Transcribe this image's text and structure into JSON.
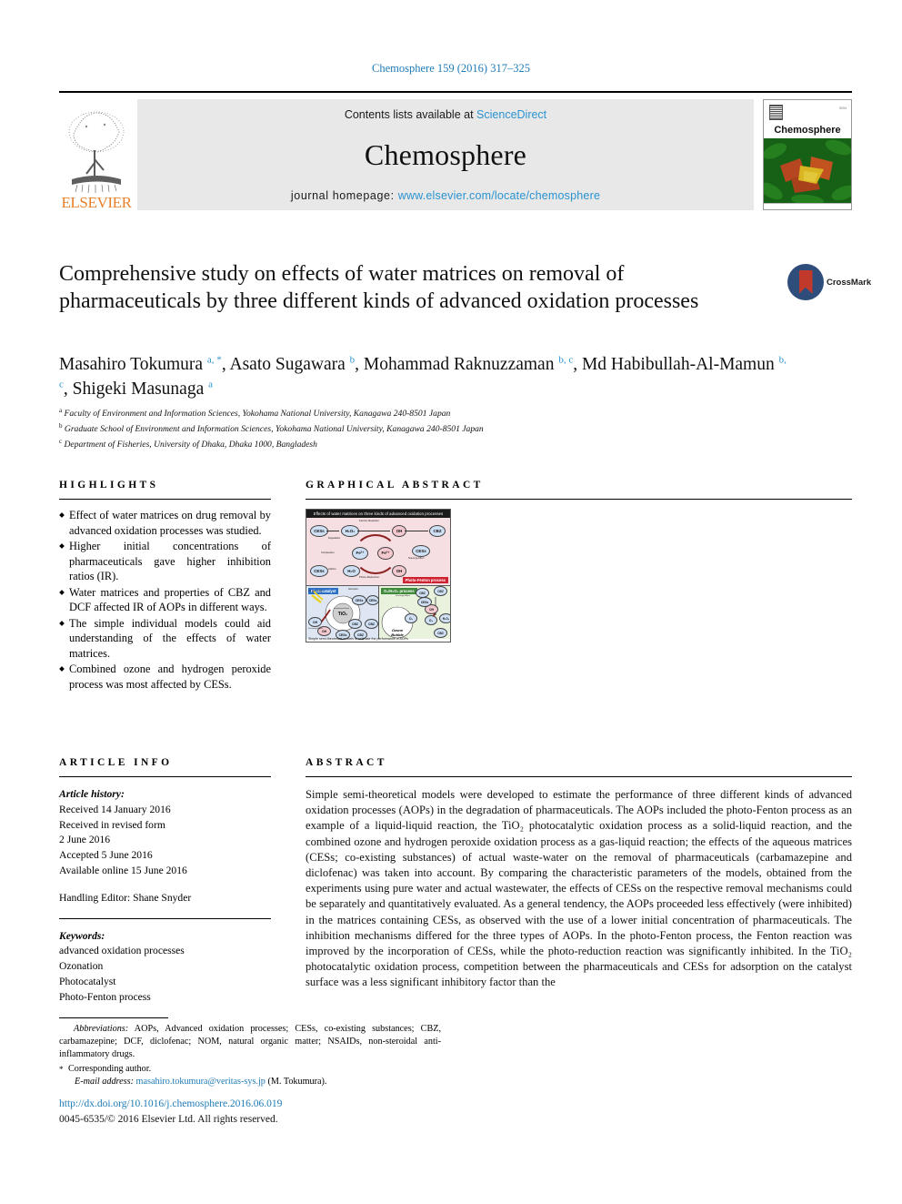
{
  "running_head": "Chemosphere 159 (2016) 317–325",
  "masthead": {
    "contents_prefix": "Contents lists available at",
    "contents_link": "ScienceDirect",
    "journal_name": "Chemosphere",
    "homepage_prefix": "journal homepage:",
    "homepage_url": "www.elsevier.com/locate/chemosphere",
    "publisher_logo_text": "ELSEVIER",
    "cover_title": "Chemosphere",
    "link_color": "#2a93d0",
    "elsevier_orange": "#e8802a"
  },
  "title": "Comprehensive study on effects of water matrices on removal of pharmaceuticals by three different kinds of advanced oxidation processes",
  "crossmark": {
    "label": "CrossMark"
  },
  "authors": [
    {
      "name": "Masahiro Tokumura",
      "marks": "a, *",
      "sep": ", "
    },
    {
      "name": "Asato Sugawara",
      "marks": "b",
      "sep": ", "
    },
    {
      "name": "Mohammad Raknuzzaman",
      "marks": "b, c",
      "sep": ", "
    },
    {
      "name": "Md Habibullah-Al-Mamun",
      "marks": "b, c",
      "sep": ", "
    },
    {
      "name": "Shigeki Masunaga",
      "marks": "a",
      "sep": ""
    }
  ],
  "affiliations": [
    {
      "mark": "a",
      "text": "Faculty of Environment and Information Sciences, Yokohama National University, Kanagawa 240-8501 Japan"
    },
    {
      "mark": "b",
      "text": "Graduate School of Environment and Information Sciences, Yokohama National University, Kanagawa 240-8501 Japan"
    },
    {
      "mark": "c",
      "text": "Department of Fisheries, University of Dhaka, Dhaka 1000, Bangladesh"
    }
  ],
  "sections": {
    "highlights_heading": "HIGHLIGHTS",
    "graphical_abstract_heading": "GRAPHICAL ABSTRACT",
    "article_info_heading": "ARTICLE INFO",
    "abstract_heading": "ABSTRACT"
  },
  "highlights": [
    "Effect of water matrices on drug removal by advanced oxidation processes was studied.",
    "Higher initial concentrations of pharmaceuticals gave higher inhibition ratios (IR).",
    "Water matrices and properties of CBZ and DCF affected IR of AOPs in different ways.",
    "The simple individual models could aid understanding of the effects of water matrices.",
    "Combined ozone and hydrogen peroxide process was most affected by CESs."
  ],
  "graphical_abstract": {
    "banner": "Effects of water matrices on three kinds of advanced oxidation processes",
    "caption": "Simple semi-theoretical models to estimate the performance of AOPs",
    "panels": {
      "photo_fenton_tag": "Photo-Fenton process",
      "photocatalyst_tag": "Photocatalyst",
      "ozone_tag": "O₃/H₂O₂ process"
    },
    "labels": {
      "fenton_reaction": "Fenton Reaction",
      "photo_reduction": "Photo-Reduction",
      "degradation": "Degradation",
      "complexation": "Complexation",
      "addition": "Addition",
      "scavenge_effect": "Scavenge Effect",
      "adsorption": "Adsorption",
      "conduction_band": "Conduction Band",
      "valence_band": "Valence Band",
      "ozone_bubble": "Ozone Bubble",
      "uv_light": "UV light energy"
    },
    "species": [
      "CESs",
      "H₂O₂",
      "OH•",
      "CBZ",
      "Fe³⁺",
      "Fe²⁺",
      "H₂O",
      "TiO₂",
      "O₃",
      "DCF"
    ]
  },
  "article_info": {
    "history_label": "Article history:",
    "history": [
      "Received 14 January 2016",
      "Received in revised form",
      "2 June 2016",
      "Accepted 5 June 2016",
      "Available online 15 June 2016"
    ],
    "handling_editor": "Handling Editor: Shane Snyder",
    "keywords_label": "Keywords:",
    "keywords": [
      "advanced oxidation processes",
      "Ozonation",
      "Photocatalyst",
      "Photo-Fenton process"
    ]
  },
  "abstract_text": "Simple semi-theoretical models were developed to estimate the performance of three different kinds of advanced oxidation processes (AOPs) in the degradation of pharmaceuticals. The AOPs included the photo-Fenton process as an example of a liquid-liquid reaction, the TiO₂ photocatalytic oxidation process as a solid-liquid reaction, and the combined ozone and hydrogen peroxide oxidation process as a gas-liquid reaction; the effects of the aqueous matrices (CESs; co-existing substances) of actual waste-water on the removal of pharmaceuticals (carbamazepine and diclofenac) was taken into account. By comparing the characteristic parameters of the models, obtained from the experiments using pure water and actual wastewater, the effects of CESs on the respective removal mechanisms could be separately and quantitatively evaluated. As a general tendency, the AOPs proceeded less effectively (were inhibited) in the matrices containing CESs, as observed with the use of a lower initial concentration of pharmaceuticals. The inhibition mechanisms differed for the three types of AOPs. In the photo-Fenton process, the Fenton reaction was improved by the incorporation of CESs, while the photo-reduction reaction was significantly inhibited. In the TiO₂ photocatalytic oxidation process, competition between the pharmaceuticals and CESs for adsorption on the catalyst surface was a less significant inhibitory factor than the",
  "footer": {
    "abbreviations_label": "Abbreviations:",
    "abbreviations_text": "AOPs, Advanced oxidation processes; CESs, co-existing substances; CBZ, carbamazepine; DCF, diclofenac; NOM, natural organic matter; NSAIDs, non-steroidal anti-inflammatory drugs.",
    "corresponding_author": "Corresponding author.",
    "email_label": "E-mail address:",
    "email": "masahiro.tokumura@veritas-sys.jp",
    "email_suffix": "(M. Tokumura).",
    "doi": "http://dx.doi.org/10.1016/j.chemosphere.2016.06.019",
    "copyright": "0045-6535/© 2016 Elsevier Ltd. All rights reserved."
  }
}
